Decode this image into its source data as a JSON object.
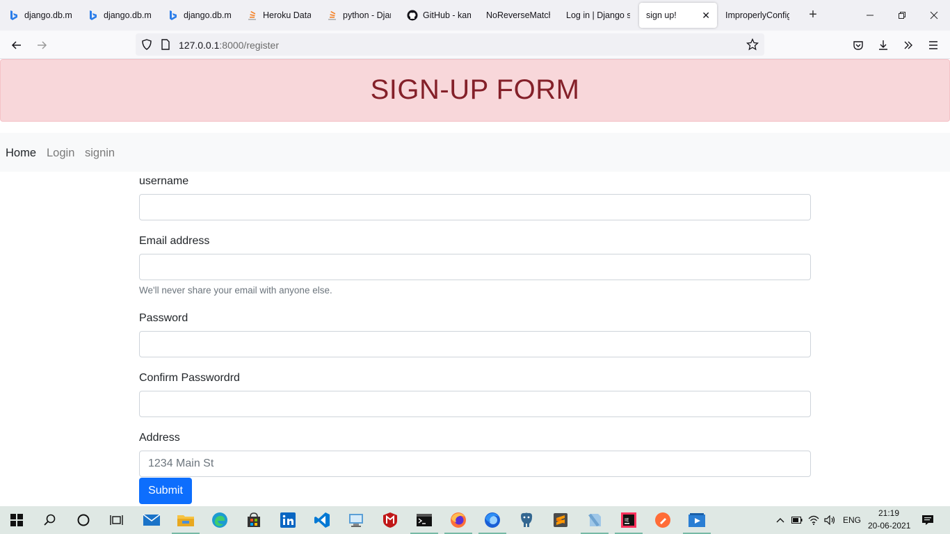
{
  "browser": {
    "tabs": [
      {
        "title": "django.db.mi",
        "icon": "bing-icon"
      },
      {
        "title": "django.db.mi",
        "icon": "bing-icon"
      },
      {
        "title": "django.db.mi",
        "icon": "bing-icon"
      },
      {
        "title": "Heroku Datab",
        "icon": "stackoverflow-icon"
      },
      {
        "title": "python - Djan",
        "icon": "stackoverflow-icon"
      },
      {
        "title": "GitHub - kam",
        "icon": "github-icon"
      },
      {
        "title": "NoReverseMatch",
        "icon": ""
      },
      {
        "title": "Log in | Django si",
        "icon": ""
      },
      {
        "title": "sign up!",
        "icon": "",
        "active": true
      },
      {
        "title": "ImproperlyConfig",
        "icon": ""
      }
    ],
    "url_host": "127.0.0.1",
    "url_path": ":8000/register"
  },
  "page": {
    "banner_title": "SIGN-UP FORM",
    "nav": {
      "home": "Home",
      "login": "Login",
      "signin": "signin"
    },
    "form": {
      "username_label": "username",
      "email_label": "Email address",
      "email_help": "We'll never share your email with anyone else.",
      "password_label": "Password",
      "confirm_label": "Confirm Passwordrd",
      "address_label": "Address",
      "address_placeholder": "1234 Main St",
      "submit_label": "Submit"
    },
    "colors": {
      "banner_bg": "#f8d7da",
      "banner_text": "#842029",
      "primary": "#0d6efd"
    }
  },
  "taskbar": {
    "language": "ENG",
    "time": "21:19",
    "date": "20-06-2021"
  }
}
